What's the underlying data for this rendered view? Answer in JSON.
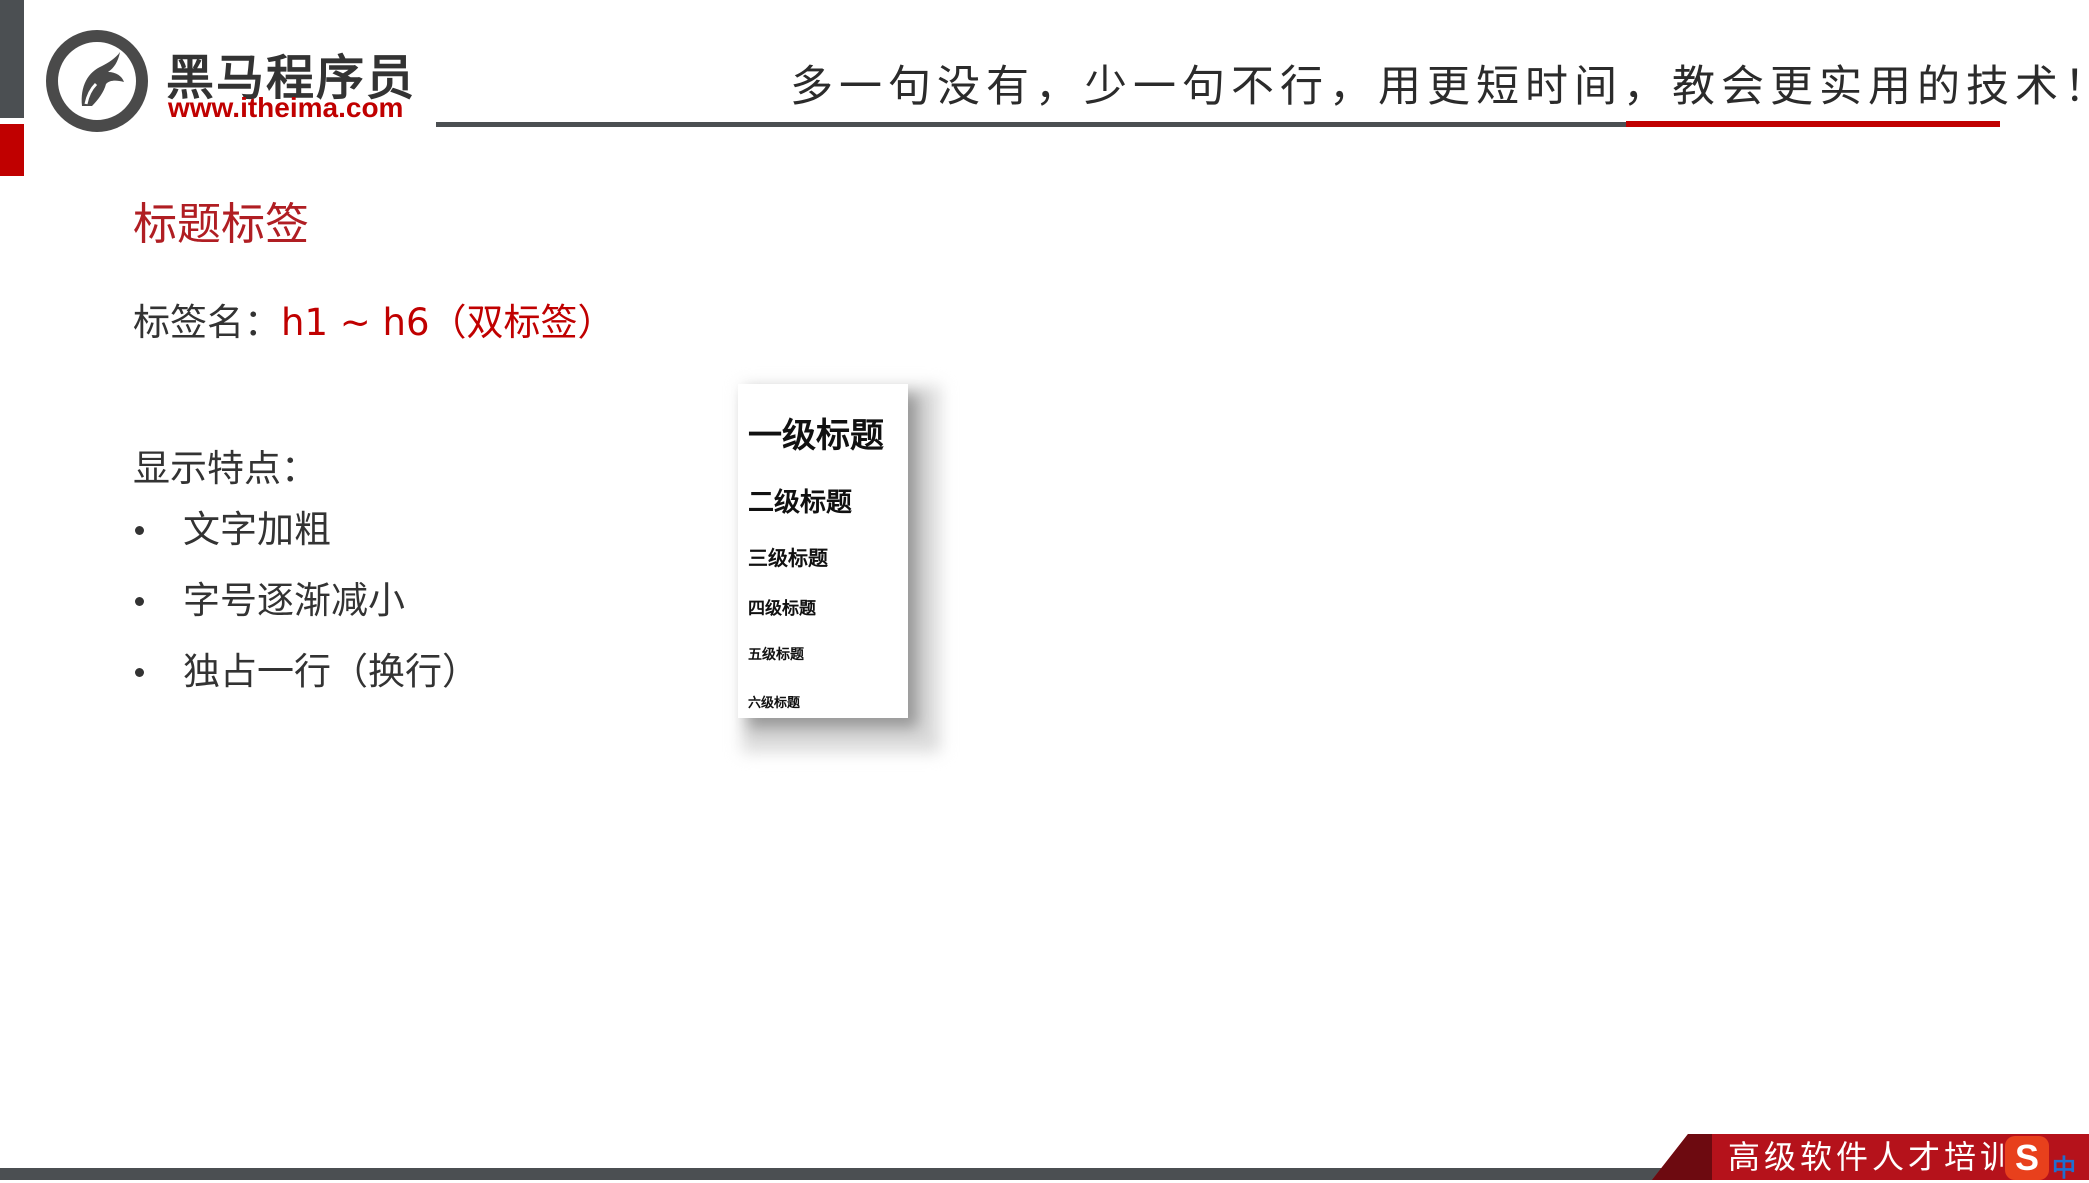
{
  "header": {
    "logo_cn": "黑马程序员",
    "logo_url": "www.itheima.com",
    "slogan": "多一句没有，少一句不行，用更短时间，教会更实用的技术！"
  },
  "content": {
    "section_title": "标题标签",
    "tag_label": "标签名：",
    "tag_value": "h1 ~ h6（双标签）",
    "features_title": "显示特点：",
    "features": [
      "文字加粗",
      "字号逐渐减小",
      "独占一行（换行）"
    ]
  },
  "preview": {
    "h1": "一级标题",
    "h2": "二级标题",
    "h3": "三级标题",
    "h4": "四级标题",
    "h5": "五级标题",
    "h6": "六级标题"
  },
  "footer": {
    "text": "高级软件人才培训",
    "ime_logo": "S",
    "ime_mode": "中"
  },
  "colors": {
    "accent_red": "#c00000",
    "title_red": "#b01e23",
    "dark_gray": "#4b4f52"
  }
}
